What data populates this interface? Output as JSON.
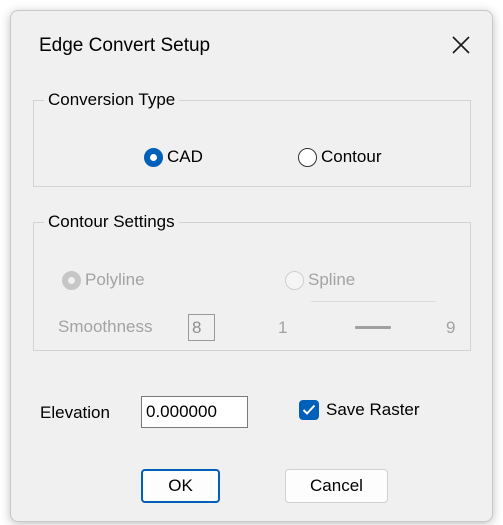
{
  "window": {
    "title": "Edge Convert Setup",
    "close_icon": "close-icon"
  },
  "conversion_type": {
    "legend": "Conversion Type",
    "options": [
      {
        "label": "CAD",
        "selected": true
      },
      {
        "label": "Contour",
        "selected": false
      }
    ]
  },
  "contour_settings": {
    "legend": "Contour Settings",
    "enabled": false,
    "options": [
      {
        "label": "Polyline",
        "selected": true
      },
      {
        "label": "Spline",
        "selected": false
      }
    ],
    "smoothness_label": "Smoothness",
    "smoothness_value": "8",
    "slider_min": "1",
    "slider_max": "9"
  },
  "elevation": {
    "label": "Elevation",
    "value": "0.000000"
  },
  "save_raster": {
    "label": "Save Raster",
    "checked": true
  },
  "buttons": {
    "ok": "OK",
    "cancel": "Cancel"
  },
  "colors": {
    "accent": "#005fb8",
    "dialog_bg": "#f0f0f0",
    "disabled_text": "#a3a3a3"
  }
}
